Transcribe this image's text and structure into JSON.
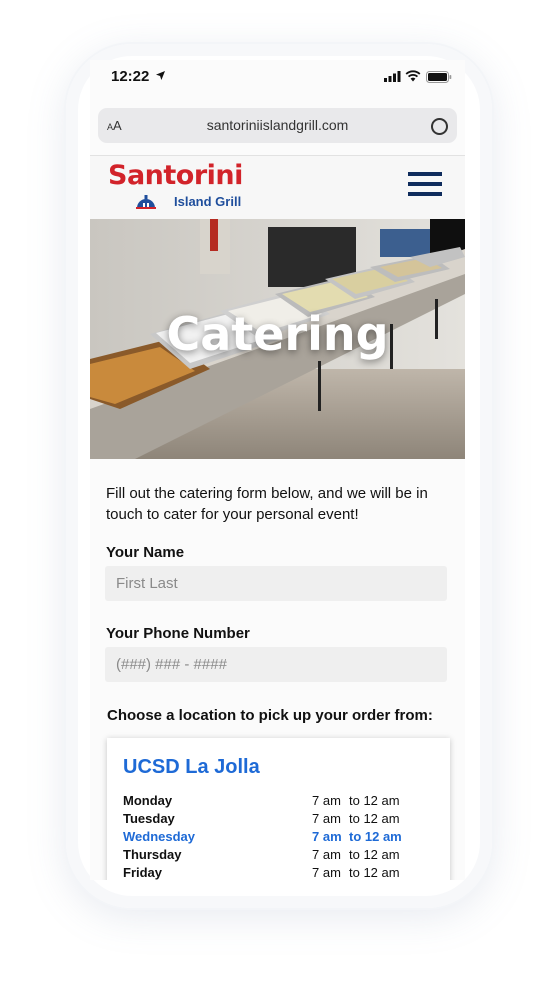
{
  "status_bar": {
    "time": "12:22"
  },
  "browser": {
    "aa_small": "A",
    "aa_large": "A",
    "url": "santoriniislandgrill.com"
  },
  "header": {
    "logo_main": "Santorini",
    "logo_sub": "Island Grill"
  },
  "hero": {
    "title": "Catering"
  },
  "intro": {
    "text": "Fill out the catering form below, and we will be in touch to cater for your personal event!"
  },
  "form": {
    "name_label": "Your Name",
    "name_placeholder": "First Last",
    "phone_label": "Your Phone Number",
    "phone_placeholder": "(###) ### - ####"
  },
  "location": {
    "heading": "Choose a location to pick up your order from:",
    "card_title": "UCSD La Jolla",
    "hours": [
      {
        "day": "Monday",
        "open": "7 am",
        "close": "to 12 am"
      },
      {
        "day": "Tuesday",
        "open": "7 am",
        "close": "to 12 am"
      },
      {
        "day": "Wednesday",
        "open": "7 am",
        "close": "to 12 am",
        "active": true
      },
      {
        "day": "Thursday",
        "open": "7 am",
        "close": "to 12 am"
      },
      {
        "day": "Friday",
        "open": "7 am",
        "close": "to 12 am"
      }
    ]
  },
  "colors": {
    "brand_red": "#d2232a",
    "brand_navy": "#0f2c5c",
    "accent_blue": "#1e6ad6"
  }
}
